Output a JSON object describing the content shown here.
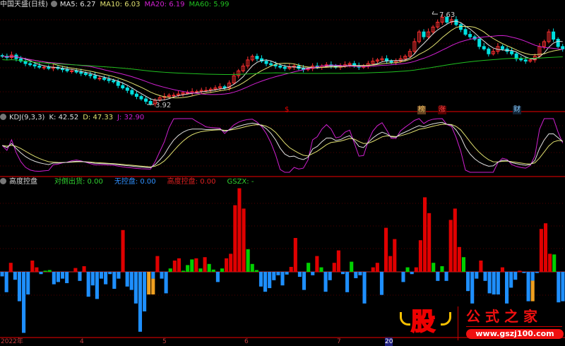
{
  "main": {
    "title": "中国天盛(日线)",
    "ma5": "MA5: 6.27",
    "ma10": "MA10: 6.03",
    "ma20": "MA20: 6.19",
    "ma60": "MA60: 5.99",
    "high_label": "7.63",
    "low_label": "3.92",
    "signals": [
      "$",
      "榜",
      "涨",
      "财"
    ]
  },
  "kdj": {
    "title": "KDJ(9,3,3)",
    "k": "K: 42.52",
    "d": "D: 47.33",
    "j": "J: 32.90"
  },
  "ctrl": {
    "title": "高度控盘",
    "a": "对倒出货: 0.00",
    "b": "无控盘: 0.00",
    "c": "高度控盘: 0.00",
    "d": "GSZX: -"
  },
  "axis": [
    "2022年",
    "4",
    "5",
    "6",
    "7",
    "20"
  ],
  "watermark": {
    "logo": "股",
    "title": "公式之家",
    "url": "www.gszj100.com"
  },
  "colors": {
    "up": "#ff3030",
    "down": "#00e0e0",
    "ma5": "#e0e0e0",
    "ma10": "#e0e070",
    "ma20": "#d020d0",
    "ma60": "#20c020",
    "red": "#e00000",
    "blue": "#1e8fff",
    "green": "#00d000",
    "orange": "#f0a020"
  },
  "chart_data": {
    "type": "candlestick+indicators",
    "closes": [
      5.9,
      5.85,
      5.95,
      5.8,
      5.7,
      5.6,
      5.55,
      5.5,
      5.45,
      5.45,
      5.4,
      5.45,
      5.4,
      5.35,
      5.3,
      5.3,
      5.25,
      5.2,
      5.15,
      5.1,
      5.0,
      5.0,
      4.95,
      4.9,
      4.85,
      4.7,
      4.6,
      4.5,
      4.35,
      4.25,
      4.15,
      4.05,
      3.95,
      4.1,
      4.2,
      4.25,
      4.3,
      4.3,
      4.35,
      4.4,
      4.4,
      4.45,
      4.45,
      4.5,
      4.5,
      4.55,
      4.6,
      4.65,
      4.6,
      4.8,
      5.1,
      5.3,
      5.5,
      5.75,
      5.9,
      5.8,
      5.7,
      5.6,
      5.55,
      5.5,
      5.45,
      5.4,
      5.45,
      5.5,
      5.4,
      5.35,
      5.4,
      5.5,
      5.45,
      5.5,
      5.55,
      5.5,
      5.45,
      5.5,
      5.55,
      5.6,
      5.5,
      5.45,
      5.5,
      5.6,
      5.7,
      5.75,
      5.8,
      5.7,
      5.65,
      5.7,
      5.8,
      5.9,
      6.1,
      6.5,
      6.9,
      6.7,
      6.9,
      7.1,
      7.3,
      7.5,
      7.3,
      7.4,
      7.2,
      7.0,
      6.8,
      6.7,
      6.6,
      6.3,
      6.2,
      6.0,
      6.1,
      6.3,
      6.2,
      6.1,
      6.0,
      5.8,
      5.75,
      5.7,
      5.75,
      5.9,
      6.3,
      6.5,
      6.9,
      6.6,
      6.3,
      6.2
    ],
    "price_high": 7.63,
    "price_low": 3.92,
    "control_bars": [
      [
        "b",
        -0.2
      ],
      [
        "b",
        -0.9
      ],
      [
        "r",
        0.4
      ],
      [
        "b",
        -0.35
      ],
      [
        "b",
        -1.3
      ],
      [
        "b",
        -2.7
      ],
      [
        "b",
        -1.0
      ],
      [
        "r",
        0.5
      ],
      [
        "r",
        0.2
      ],
      [
        "b",
        -0.1
      ],
      [
        "g",
        0.05
      ],
      [
        "g",
        0.08
      ],
      [
        "b",
        -0.55
      ],
      [
        "b",
        -0.45
      ],
      [
        "b",
        -0.3
      ],
      [
        "b",
        -0.5
      ],
      [
        "r",
        0
      ],
      [
        "r",
        0.17
      ],
      [
        "b",
        -0.4
      ],
      [
        "r",
        0.25
      ],
      [
        "b",
        -1.1
      ],
      [
        "b",
        -0.6
      ],
      [
        "b",
        -1.2
      ],
      [
        "b",
        -0.3
      ],
      [
        "b",
        -0.55
      ],
      [
        "b",
        -0.1
      ],
      [
        "b",
        -0.75
      ],
      [
        "b",
        -0.3
      ],
      [
        "r",
        1.85
      ],
      [
        "b",
        -0.65
      ],
      [
        "b",
        -0.8
      ],
      [
        "b",
        -1.4
      ],
      [
        "b",
        -2.65
      ],
      [
        "b",
        -1.75
      ],
      [
        "o",
        -1.0
      ],
      [
        "bo",
        -1.0
      ],
      [
        "r",
        0.7
      ],
      [
        "b",
        -0.3
      ],
      [
        "b",
        -0.95
      ],
      [
        "g",
        0.15
      ],
      [
        "r",
        0.5
      ],
      [
        "r",
        0.6
      ],
      [
        "g",
        0.05
      ],
      [
        "g",
        0.3
      ],
      [
        "g",
        0.55
      ],
      [
        "r",
        0.6
      ],
      [
        "g",
        0.15
      ],
      [
        "r",
        0.65
      ],
      [
        "g",
        0.35
      ],
      [
        "g",
        0.1
      ],
      [
        "b",
        -0.45
      ],
      [
        "g",
        0.15
      ],
      [
        "r",
        0.6
      ],
      [
        "r",
        0.8
      ],
      [
        "r",
        2.95
      ],
      [
        "r",
        3.7
      ],
      [
        "r",
        2.8
      ],
      [
        "g",
        1.0
      ],
      [
        "g",
        0.35
      ],
      [
        "g",
        0.08
      ],
      [
        "b",
        -0.65
      ],
      [
        "b",
        -0.88
      ],
      [
        "b",
        -0.72
      ],
      [
        "b",
        -0.37
      ],
      [
        "b",
        -0.15
      ],
      [
        "b",
        -0.6
      ],
      [
        "b",
        -0.12
      ],
      [
        "r",
        0.22
      ],
      [
        "r",
        1.5
      ],
      [
        "b",
        -0.22
      ],
      [
        "b",
        -0.8
      ],
      [
        "g",
        0.4
      ],
      [
        "b",
        -0.15
      ],
      [
        "r",
        0.7
      ],
      [
        "g",
        0.2
      ],
      [
        "b",
        -0.88
      ],
      [
        "b",
        -0.37
      ],
      [
        "r",
        0.4
      ],
      [
        "r",
        0.95
      ],
      [
        "b",
        -0.1
      ],
      [
        "b",
        -0.9
      ],
      [
        "g",
        0.45
      ],
      [
        "b",
        -0.28
      ],
      [
        "b",
        -0.15
      ],
      [
        "b",
        -1.4
      ],
      [
        "r",
        0
      ],
      [
        "r",
        0.2
      ],
      [
        "r",
        0.4
      ],
      [
        "b",
        -1.02
      ],
      [
        "r",
        1.95
      ],
      [
        "r",
        0.7
      ],
      [
        "r",
        1.45
      ],
      [
        "r",
        0
      ],
      [
        "b",
        -0.45
      ],
      [
        "g",
        0.2
      ],
      [
        "b",
        -0.1
      ],
      [
        "r",
        0.2
      ],
      [
        "r",
        1.4
      ],
      [
        "r",
        3.3
      ],
      [
        "r",
        2.6
      ],
      [
        "g",
        0.4
      ],
      [
        "b",
        -0.4
      ],
      [
        "g",
        0.25
      ],
      [
        "b",
        -0.4
      ],
      [
        "r",
        2.3
      ],
      [
        "r",
        2.8
      ],
      [
        "r",
        1.1
      ],
      [
        "g",
        0.65
      ],
      [
        "b",
        -0.85
      ],
      [
        "b",
        -1.4
      ],
      [
        "b",
        -0.3
      ],
      [
        "r",
        0.5
      ],
      [
        "b",
        -0.4
      ],
      [
        "b",
        -0.95
      ],
      [
        "b",
        -1.0
      ],
      [
        "b",
        -1.0
      ],
      [
        "r",
        0.2
      ],
      [
        "b",
        -1.4
      ],
      [
        "b",
        -0.7
      ],
      [
        "b",
        -0.35
      ],
      [
        "r",
        0.05
      ],
      [
        "b",
        -0.05
      ],
      [
        "b",
        -1.3
      ],
      [
        "bo",
        -1.3
      ],
      [
        "b",
        -0.05
      ],
      [
        "r",
        1.9
      ],
      [
        "r",
        2.15
      ],
      [
        "r",
        0.8
      ],
      [
        "g",
        0.77
      ],
      [
        "b",
        -1.35
      ],
      [
        "b",
        -1.3
      ]
    ]
  }
}
